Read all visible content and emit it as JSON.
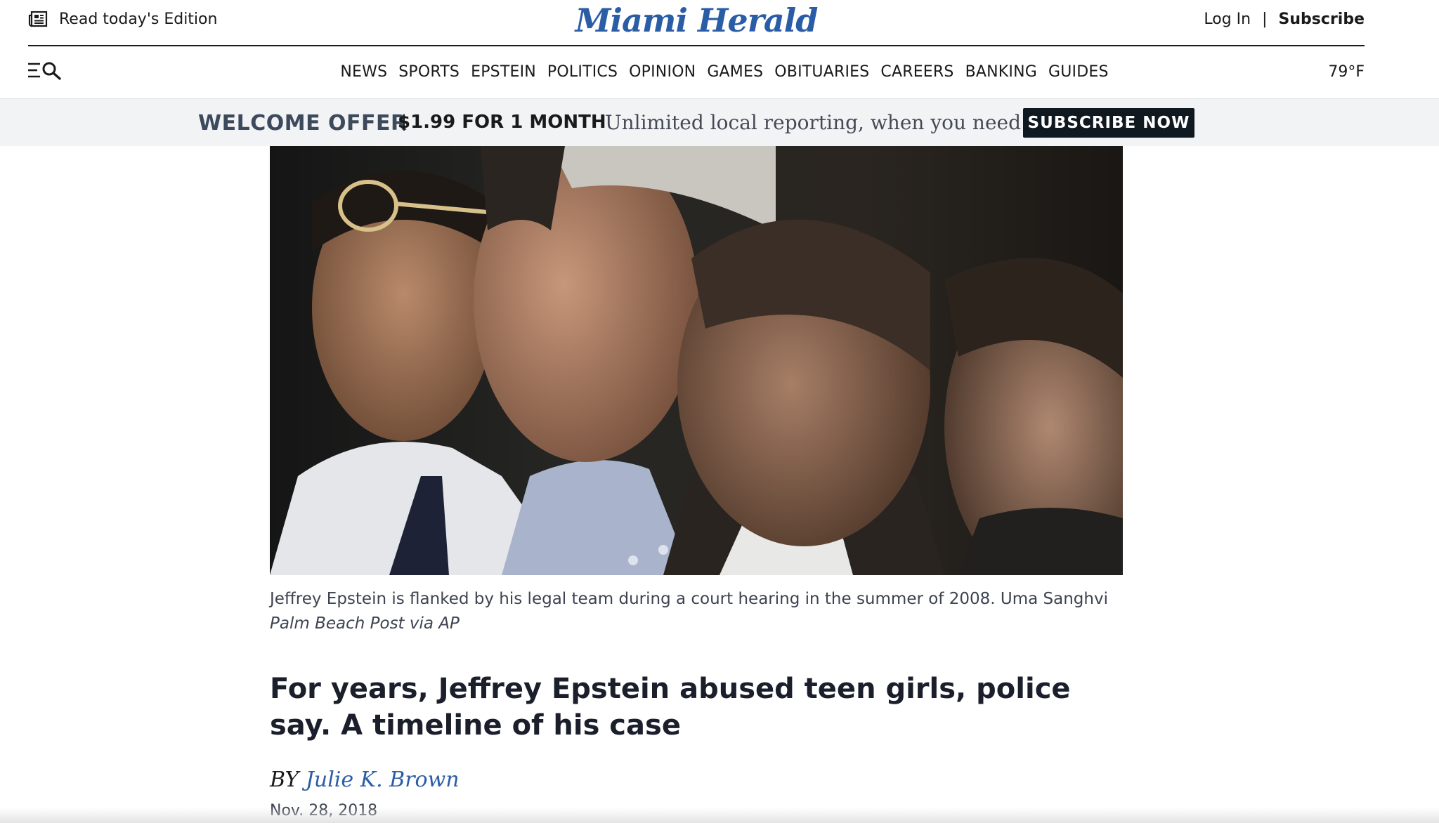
{
  "topbar": {
    "edition_label": "Read today's Edition",
    "logo_text": "Miami Herald",
    "login_label": "Log In",
    "separator": "|",
    "subscribe_label": "Subscribe"
  },
  "nav": {
    "items": [
      "NEWS",
      "SPORTS",
      "EPSTEIN",
      "POLITICS",
      "OPINION",
      "GAMES",
      "OBITUARIES",
      "CAREERS",
      "BANKING",
      "GUIDES"
    ],
    "temperature": "79°F"
  },
  "offer": {
    "title": "WELCOME OFFER",
    "price": "$1.99 FOR 1 MONTH",
    "tagline": "Unlimited local reporting, when you need it.",
    "button_label": "SUBSCRIBE NOW"
  },
  "article": {
    "caption_text": "Jeffrey Epstein is flanked by his legal team during a court hearing in the summer of 2008. Uma Sanghvi ",
    "caption_credit": "Palm Beach Post via AP",
    "headline": "For years, Jeffrey Epstein abused teen girls, police say. A timeline of his case",
    "byline_prefix": "BY ",
    "author": "Julie K. Brown",
    "date": "Nov. 28, 2018"
  },
  "colors": {
    "brand_blue": "#2b5da6",
    "offer_bg": "#f2f3f5",
    "button_bg": "#101820"
  },
  "icons": {
    "edition": "newspaper-icon",
    "menu_search": "menu-search-icon"
  }
}
